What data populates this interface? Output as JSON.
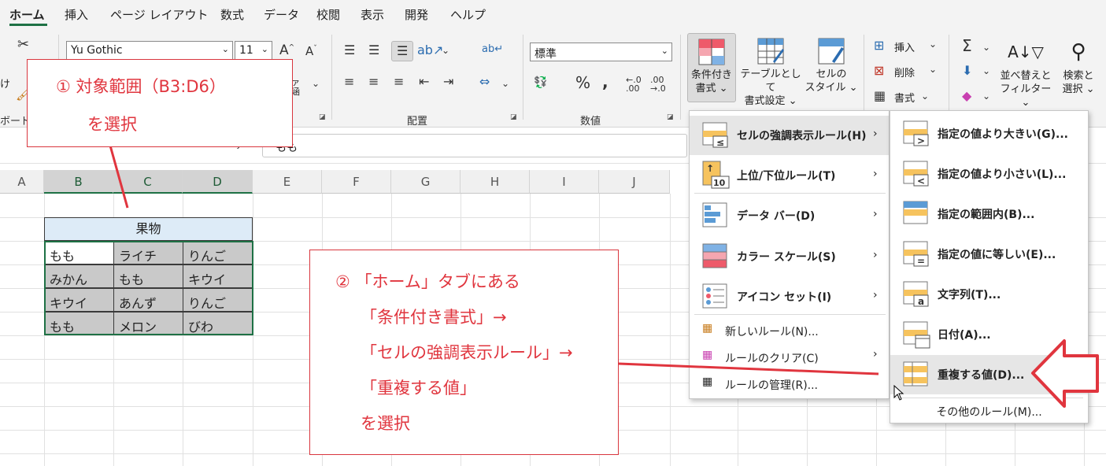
{
  "tabs": [
    "ホーム",
    "挿入",
    "ページ レイアウト",
    "数式",
    "データ",
    "校閲",
    "表示",
    "開発",
    "ヘルプ"
  ],
  "ribbon": {
    "font_name": "Yu Gothic",
    "font_size": "11",
    "number_format": "標準",
    "groups": {
      "clipboard_partial": "ボード",
      "alignment": "配置",
      "number": "数値"
    },
    "conditional_formatting": [
      "条件付き",
      "書式 ⌄"
    ],
    "format_as_table": [
      "テーブルとして",
      "書式設定 ⌄"
    ],
    "cell_styles": [
      "セルの",
      "スタイル ⌄"
    ],
    "insert": "挿入",
    "delete": "削除",
    "format": "書式",
    "sort_filter": [
      "並べ替えと",
      "フィルター ⌄"
    ],
    "find_select": [
      "検索と",
      "選択 ⌄"
    ],
    "partial_left_1": "け",
    "partial_left_2": "ァ",
    "partial_left_3": "涵"
  },
  "formula_bar": {
    "fx": "fx",
    "value": "もも"
  },
  "columns": [
    "A",
    "B",
    "C",
    "D",
    "E",
    "F",
    "G",
    "H",
    "I",
    "J"
  ],
  "table": {
    "header": "果物",
    "rows": [
      [
        "もも",
        "ライチ",
        "りんご"
      ],
      [
        "みかん",
        "もも",
        "キウイ"
      ],
      [
        "キウイ",
        "あんず",
        "りんご"
      ],
      [
        "もも",
        "メロン",
        "びわ"
      ]
    ]
  },
  "cf_menu": {
    "items": [
      "セルの強調表示ルール(H)",
      "上位/下位ルール(T)",
      "データ バー(D)",
      "カラー スケール(S)",
      "アイコン セット(I)"
    ],
    "new_rule": "新しいルール(N)...",
    "clear_rules": "ルールのクリア(C)",
    "manage_rules": "ルールの管理(R)..."
  },
  "highlight_submenu": {
    "items": [
      "指定の値より大きい(G)...",
      "指定の値より小さい(L)...",
      "指定の範囲内(B)...",
      "指定の値に等しい(E)...",
      "文字列(T)...",
      "日付(A)...",
      "重複する値(D)..."
    ],
    "more_rules": "その他のルール(M)..."
  },
  "annotations": {
    "note1": [
      "① 対象範囲（B3:D6）",
      "を選択"
    ],
    "note2": [
      "② 「ホーム」タブにある",
      "「条件付き書式」→",
      "「セルの強調表示ルール」→",
      "「重複する値」",
      "を選択"
    ]
  },
  "colors": {
    "accent": "#1e7145",
    "annotation": "#e0353e",
    "selection_fill": "#c9c9c9",
    "header_fill": "#ddebf7"
  }
}
